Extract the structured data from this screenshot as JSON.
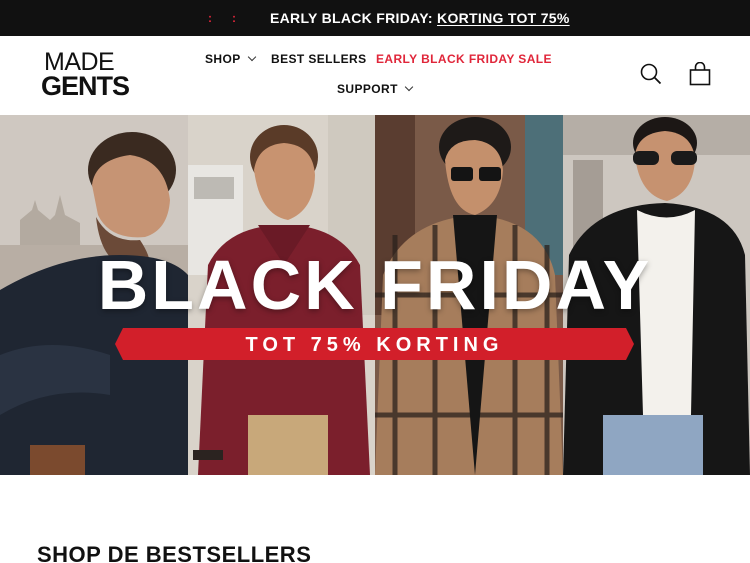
{
  "announcement": {
    "dot1": ":",
    "dot2": ":",
    "prefix": "EARLY BLACK FRIDAY: ",
    "link": "KORTING TOT 75%"
  },
  "brand": {
    "line1": "MADE",
    "line2": "GENTS"
  },
  "nav": {
    "shop": "SHOP",
    "best_sellers": "BEST SELLERS",
    "sale": "EARLY BLACK FRIDAY SALE",
    "support": "SUPPORT"
  },
  "icons": {
    "search": "search-icon",
    "cart": "cart-icon"
  },
  "hero": {
    "title": "BLACK FRIDAY",
    "ribbon": "TOT 75% KORTING"
  },
  "section": {
    "title": "SHOP DE BESTSELLERS"
  },
  "colors": {
    "accent": "#e0263a",
    "announce_bg": "#111111",
    "ribbon": "#d21f2a"
  }
}
